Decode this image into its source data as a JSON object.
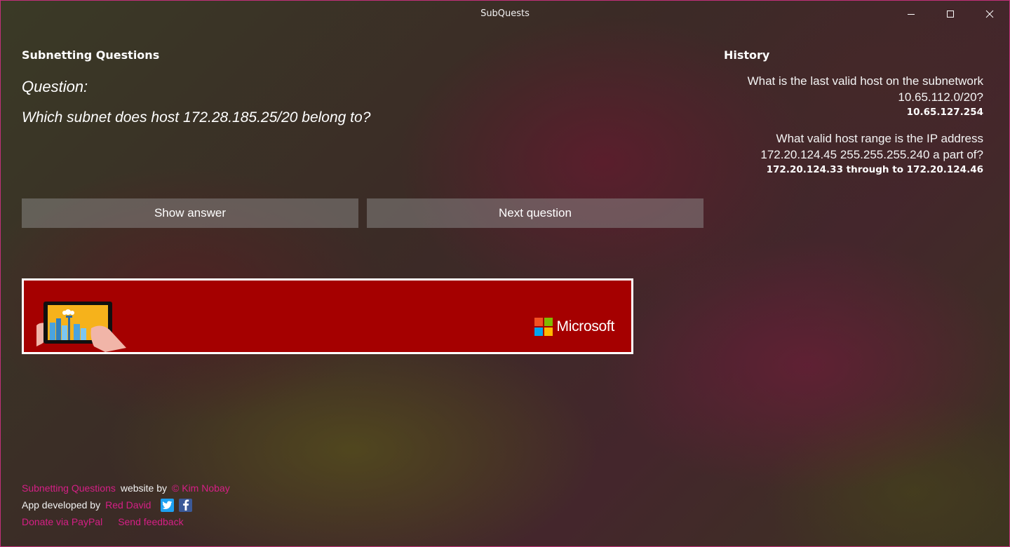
{
  "window": {
    "title": "SubQuests",
    "controls": {
      "minimize": "minimize-icon",
      "maximize": "maximize-icon",
      "close": "close-icon"
    }
  },
  "main": {
    "heading": "Subnetting Questions",
    "question_label": "Question:",
    "question_text": "Which subnet does host 172.28.185.25/20 belong to?",
    "show_answer_label": "Show answer",
    "next_question_label": "Next question"
  },
  "ad": {
    "brand": "Microsoft",
    "background_color": "#a50000",
    "logo_colors": [
      "#f25022",
      "#7fba00",
      "#00a4ef",
      "#ffb900"
    ]
  },
  "history": {
    "title": "History",
    "items": [
      {
        "question": "What is the last valid host on the subnetwork 10.65.112.0/20?",
        "answer": "10.65.127.254"
      },
      {
        "question": "What valid host range is the IP address 172.20.124.45 255.255.255.240 a part of?",
        "answer": "172.20.124.33 through to 172.20.124.46"
      }
    ]
  },
  "footer": {
    "line1": {
      "site_link": "Subnetting Questions",
      "website_by": "website by",
      "author_link": "© Kim Nobay"
    },
    "line2": {
      "developed_by": "App developed by",
      "developer_link": "Red David",
      "twitter_icon": "twitter-icon",
      "facebook_icon": "facebook-icon"
    },
    "line3": {
      "donate_link": "Donate via PayPal",
      "feedback_link": "Send feedback"
    }
  },
  "colors": {
    "accent": "#d61f86",
    "window_border": "#c2307a",
    "button_bg": "rgba(150,150,150,0.45)"
  }
}
